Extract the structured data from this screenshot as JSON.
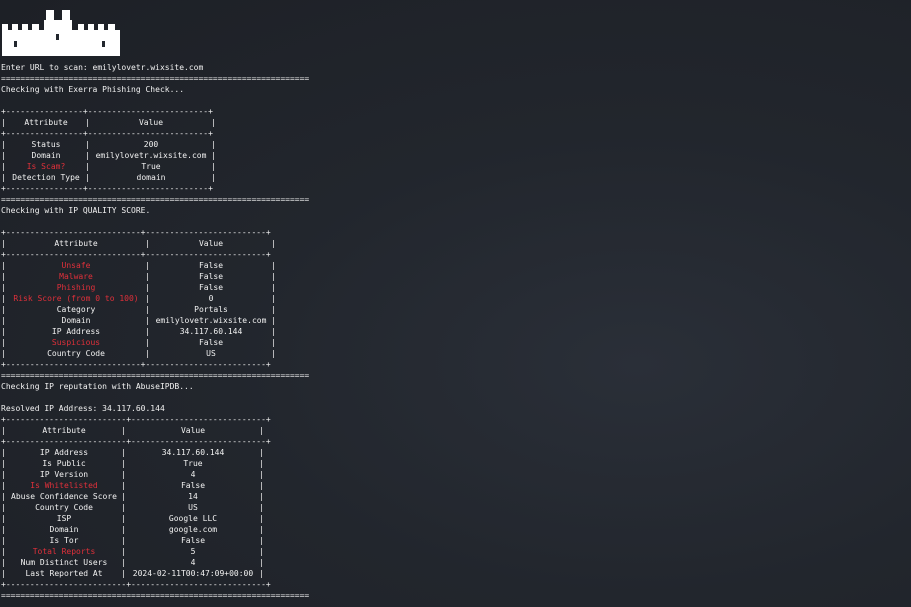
{
  "prompt_label": "Enter URL to scan: ",
  "url": "emilylovetr.wixsite.com",
  "separator": "================================================================",
  "section1": {
    "heading": "Checking with Exerra Phishing Check...",
    "border_top": "+----------------+-------------------------+",
    "header_attr": "Attribute",
    "header_value": "Value",
    "rows": [
      {
        "attr": "Status",
        "value": "200",
        "red": false
      },
      {
        "attr": "Domain",
        "value": "emilylovetr.wixsite.com",
        "red": false
      },
      {
        "attr": "Is Scam?",
        "value": "True",
        "red": true
      },
      {
        "attr": "Detection Type",
        "value": "domain",
        "red": false
      }
    ]
  },
  "section2": {
    "heading": "Checking with IP QUALITY SCORE.",
    "border_top": "+----------------------------+-------------------------+",
    "header_attr": "Attribute",
    "header_value": "Value",
    "rows": [
      {
        "attr": "Unsafe",
        "value": "False",
        "red": true
      },
      {
        "attr": "Malware",
        "value": "False",
        "red": true
      },
      {
        "attr": "Phishing",
        "value": "False",
        "red": true
      },
      {
        "attr": "Risk Score (from 0 to 100)",
        "value": "0",
        "red": true
      },
      {
        "attr": "Category",
        "value": "Portals",
        "red": false
      },
      {
        "attr": "Domain",
        "value": "emilylovetr.wixsite.com",
        "red": false
      },
      {
        "attr": "IP Address",
        "value": "34.117.60.144",
        "red": false
      },
      {
        "attr": "Suspicious",
        "value": "False",
        "red": true
      },
      {
        "attr": "Country Code",
        "value": "US",
        "red": false
      }
    ]
  },
  "section3": {
    "heading": "Checking IP reputation with AbuseIPDB...",
    "resolved": "Resolved IP Address: 34.117.60.144",
    "border_top": "+-------------------------+----------------------------+",
    "header_attr": "Attribute",
    "header_value": "Value",
    "rows": [
      {
        "attr": "IP Address",
        "value": "34.117.60.144",
        "red": false
      },
      {
        "attr": "Is Public",
        "value": "True",
        "red": false
      },
      {
        "attr": "IP Version",
        "value": "4",
        "red": false
      },
      {
        "attr": "Is Whitelisted",
        "value": "False",
        "red": true
      },
      {
        "attr": "Abuse Confidence Score",
        "value": "14",
        "red": false
      },
      {
        "attr": "Country Code",
        "value": "US",
        "red": false
      },
      {
        "attr": "ISP",
        "value": "Google LLC",
        "red": false
      },
      {
        "attr": "Domain",
        "value": "google.com",
        "red": false
      },
      {
        "attr": "Is Tor",
        "value": "False",
        "red": false
      },
      {
        "attr": "Total Reports",
        "value": "5",
        "red": true
      },
      {
        "attr": "Num Distinct Users",
        "value": "4",
        "red": false
      },
      {
        "attr": "Last Reported At",
        "value": "2024-02-11T00:47:09+00:00",
        "red": false
      }
    ]
  },
  "colors": {
    "background": "#22262d",
    "text": "#f2f2f2",
    "highlight": "#e0303a"
  }
}
